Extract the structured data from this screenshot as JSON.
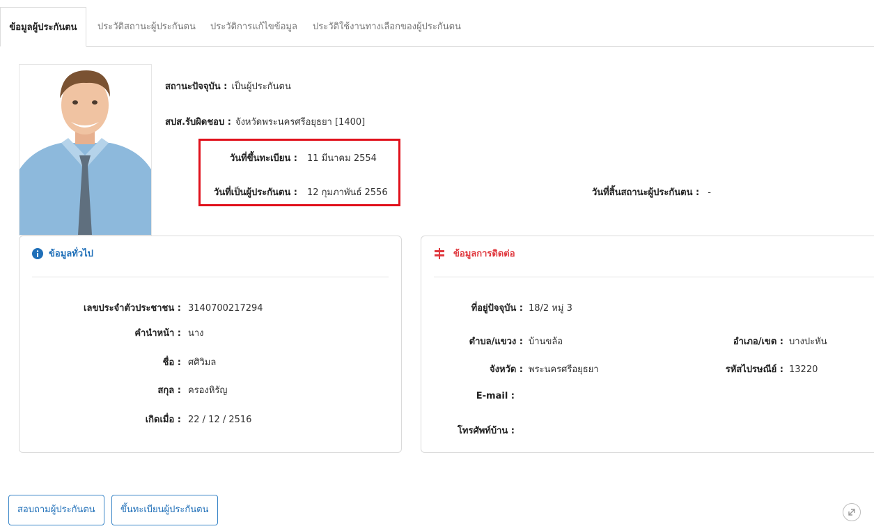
{
  "tabs": [
    {
      "label": "ข้อมูลผู้ประกันตน"
    },
    {
      "label": "ประวัติสถานะผู้ประกันตน"
    },
    {
      "label": "ประวัติการแก้ไขข้อมูล"
    },
    {
      "label": "ประวัติใช้งานทางเลือกของผู้ประกันตน"
    }
  ],
  "profile": {
    "status": {
      "label": "สถานะปัจจุบัน :",
      "value": "เป็นผู้ประกันตน"
    },
    "office": {
      "label": "สปส.รับผิดชอบ :",
      "value": "จังหวัดพระนครศรีอยุธยา [1400]"
    },
    "registered": {
      "label": "วันที่ขึ้นทะเบียน :",
      "value": "11 มีนาคม 2554"
    },
    "insured_since": {
      "label": "วันที่เป็นผู้ประกันตน :",
      "value": "12 กุมภาพันธ์ 2556"
    },
    "insured_end": {
      "label": "วันที่สิ้นสถานะผู้ประกันตน :",
      "value": "-"
    }
  },
  "general": {
    "title": "ข้อมูลทั่วไป",
    "icon": "info-circle-icon",
    "fields": [
      {
        "label": "เลขประจำตัวประชาชน :",
        "value": "3140700217294"
      },
      {
        "label": "คำนำหน้า :",
        "value": "นาง"
      },
      {
        "label": "ชื่อ :",
        "value": "ศศิวิมล"
      },
      {
        "label": "สกุล :",
        "value": "ครองหิรัญ"
      },
      {
        "label": "เกิดเมื่อ :",
        "value": "22 / 12 / 2516"
      }
    ]
  },
  "contact": {
    "title": "ข้อมูลการติดต่อ",
    "icon": "signpost-icon",
    "address": {
      "label": "ที่อยู่ปัจจุบัน :",
      "value": "18/2 หมู่ 3"
    },
    "subdistrict": {
      "label": "ตำบล/แขวง :",
      "value": "บ้านขล้อ"
    },
    "district": {
      "label": "อำเภอ/เขต :",
      "value": "บางปะหัน"
    },
    "province": {
      "label": "จังหวัด :",
      "value": "พระนครศรีอยุธยา"
    },
    "postcode": {
      "label": "รหัสไปรษณีย์ :",
      "value": "13220"
    },
    "email": {
      "label": "E-mail :",
      "value": ""
    },
    "home_phone": {
      "label": "โทรศัพท์บ้าน :",
      "value": ""
    }
  },
  "buttons": {
    "inquire": "สอบถามผู้ประกันตน",
    "register": "ขึ้นทะเบียนผู้ประกันตน"
  },
  "colors": {
    "accent_blue": "#1f6fb8",
    "highlight_red": "#e0101b",
    "contact_icon_red": "#e0383e"
  }
}
